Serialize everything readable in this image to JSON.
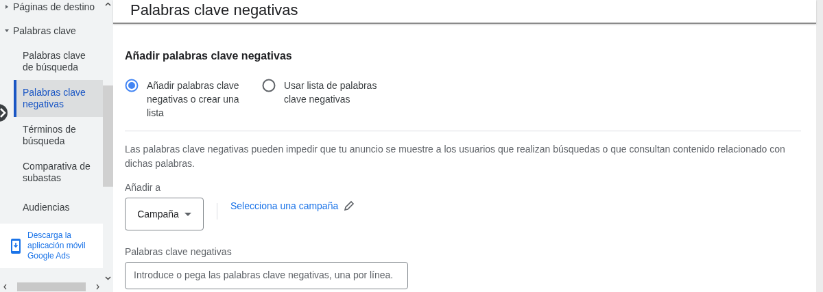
{
  "sidebar": {
    "items": [
      {
        "label": "Páginas de destino",
        "kind": "group",
        "expanded": false
      },
      {
        "label": "Palabras clave",
        "kind": "group",
        "expanded": true,
        "children": [
          {
            "label": "Palabras clave de búsqueda",
            "selected": false
          },
          {
            "label": "Palabras clave negativas",
            "selected": true
          },
          {
            "label": "Términos de búsqueda",
            "selected": false
          },
          {
            "label": "Comparativa de subastas",
            "selected": false
          }
        ]
      },
      {
        "label": "Audiencias",
        "kind": "link"
      }
    ],
    "app_promo": "Descarga la aplicación móvil Google Ads"
  },
  "page": {
    "title": "Palabras clave negativas",
    "section_title": "Añadir palabras clave negativas",
    "options": [
      {
        "label": "Añadir palabras clave negativas o crear una lista",
        "selected": true
      },
      {
        "label": "Usar lista de palabras clave negativas",
        "selected": false
      }
    ],
    "description": "Las palabras clave negativas pueden impedir que tu anuncio se muestre a los usuarios que realizan búsquedas o que consultan contenido relacionado con dichas palabras.",
    "add_to_label": "Añadir a",
    "add_to_value": "Campaña",
    "campaign_link": "Selecciona una campaña",
    "keywords_label": "Palabras clave negativas",
    "keywords_placeholder": "Introduce o pega las palabras clave negativas, una por línea."
  }
}
